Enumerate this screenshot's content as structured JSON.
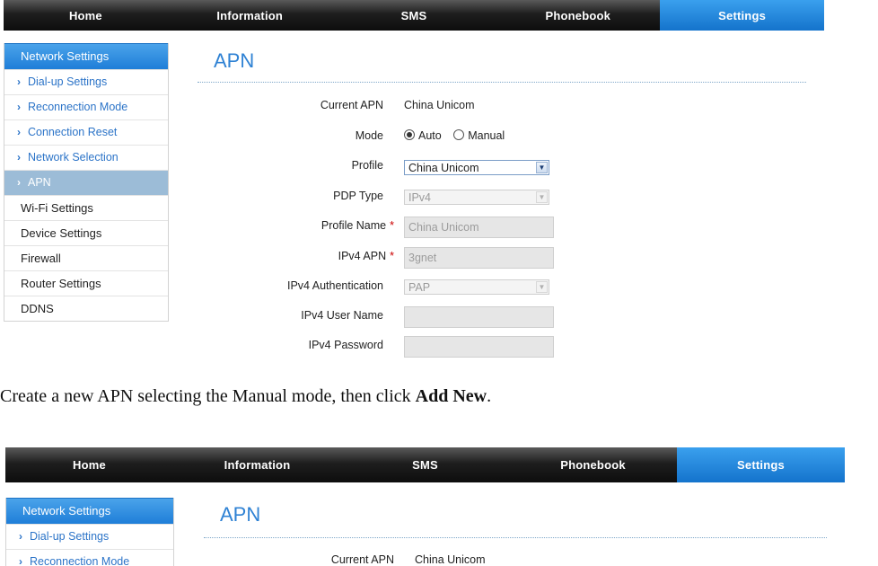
{
  "nav": {
    "items": [
      {
        "label": "Home"
      },
      {
        "label": "Information"
      },
      {
        "label": "SMS"
      },
      {
        "label": "Phonebook"
      },
      {
        "label": "Settings"
      }
    ],
    "active": "Settings",
    "active_color": "#1e7fd6"
  },
  "sidebar": {
    "header": "Network Settings",
    "sub_items": [
      {
        "label": "Dial-up Settings"
      },
      {
        "label": "Reconnection Mode"
      },
      {
        "label": "Connection Reset"
      },
      {
        "label": "Network Selection"
      },
      {
        "label": "APN"
      }
    ],
    "active_sub": "APN",
    "main_items": [
      {
        "label": "Wi-Fi Settings"
      },
      {
        "label": "Device Settings"
      },
      {
        "label": "Firewall"
      },
      {
        "label": "Router Settings"
      },
      {
        "label": "DDNS"
      }
    ]
  },
  "apn_page": {
    "title": "APN",
    "current_apn": {
      "label": "Current APN",
      "value": "China Unicom"
    },
    "mode": {
      "label": "Mode",
      "options": [
        "Auto",
        "Manual"
      ],
      "selected": "Auto"
    },
    "profile": {
      "label": "Profile",
      "value": "China Unicom"
    },
    "pdp_type": {
      "label": "PDP Type",
      "value": "IPv4"
    },
    "profile_name": {
      "label": "Profile Name",
      "required_mark": "*",
      "value": "China Unicom"
    },
    "ipv4_apn": {
      "label": "IPv4 APN",
      "required_mark": "*",
      "value": "3gnet"
    },
    "ipv4_auth": {
      "label": "IPv4 Authentication",
      "value": "PAP"
    },
    "ipv4_user": {
      "label": "IPv4 User Name",
      "value": ""
    },
    "ipv4_password": {
      "label": "IPv4 Password",
      "value": ""
    }
  },
  "caption": {
    "before": "Create a new APN selecting the Manual mode, then click ",
    "bold": "Add New",
    "after": "."
  },
  "colors": {
    "accent_blue": "#1e7fd6",
    "link_blue": "#2c74c8",
    "required_red": "#cc0000",
    "active_sub_bg": "#9cbcd7"
  }
}
